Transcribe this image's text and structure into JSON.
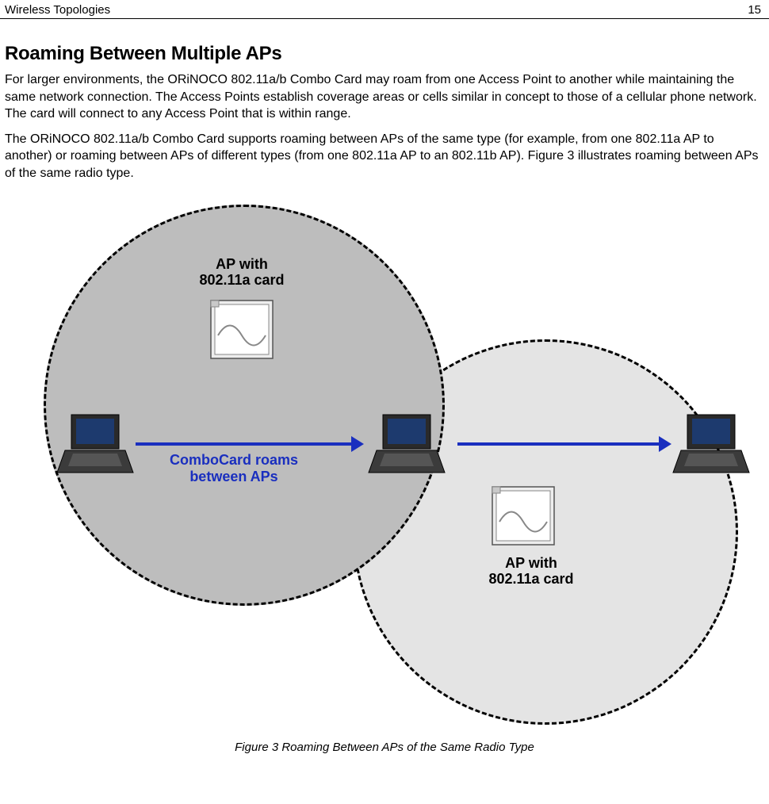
{
  "header": {
    "left": "Wireless Topologies",
    "right": "15"
  },
  "section_title": "Roaming Between Multiple APs",
  "paragraphs": [
    "For larger environments, the ORiNOCO 802.11a/b Combo Card may roam from one Access Point to another while maintaining the same network connection. The Access Points establish coverage areas or cells similar in concept to those of a cellular phone network. The card will connect to any Access Point that is within range.",
    "The ORiNOCO 802.11a/b Combo Card supports roaming between APs of the same type (for example, from one 802.11a AP to another) or roaming between APs of different types (from one 802.11a AP to an 802.11b AP). Figure 3 illustrates roaming between APs of the same radio type."
  ],
  "figure": {
    "ap_label_1a": "AP with",
    "ap_label_1b": "802.11a card",
    "ap_label_2a": "AP with",
    "ap_label_2b": "802.11a card",
    "roam_line1": "ComboCard roams",
    "roam_line2": "between APs",
    "caption": "Figure 3 Roaming Between APs of the Same Radio Type"
  }
}
